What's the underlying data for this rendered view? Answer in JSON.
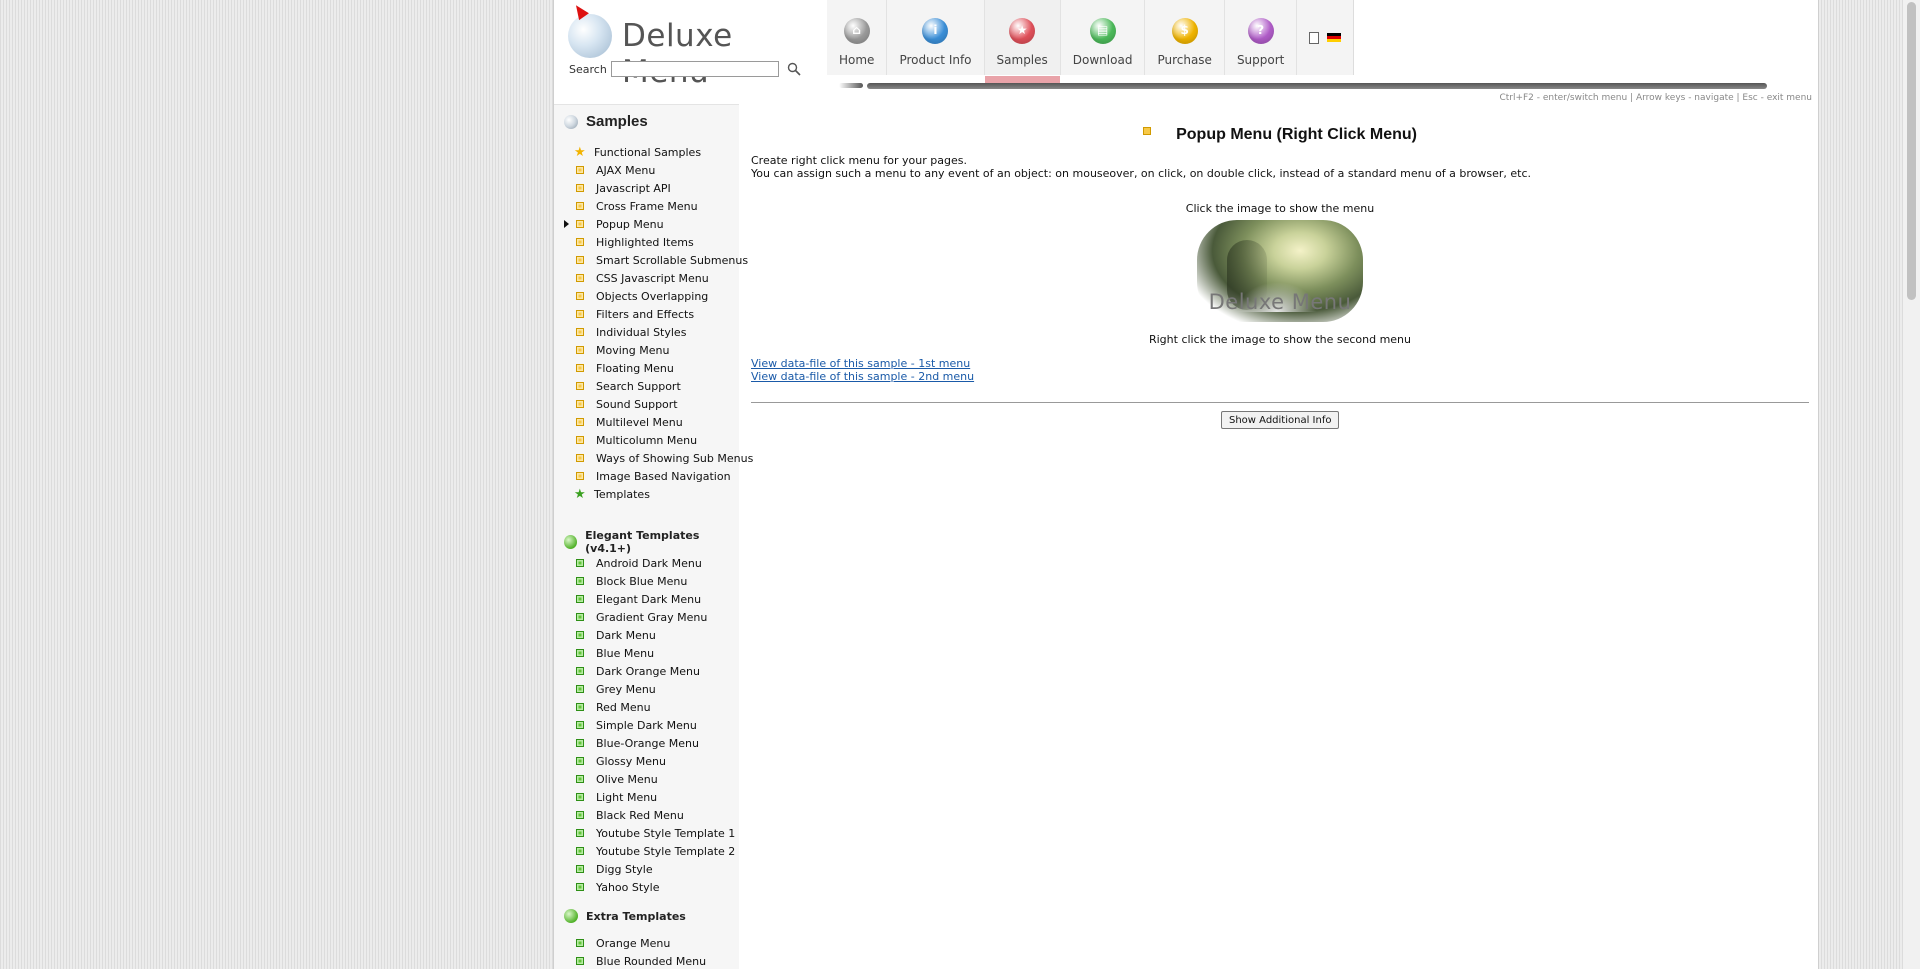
{
  "header": {
    "logo_text": "Deluxe Menu",
    "search_label": "Search",
    "search_value": "",
    "hint": "Ctrl+F2 - enter/switch menu | Arrow keys - navigate | Esc - exit menu"
  },
  "nav": {
    "items": [
      {
        "label": "Home",
        "color": "#9a9a9a",
        "icon": "home-icon"
      },
      {
        "label": "Product Info",
        "color": "#3b8fd8",
        "icon": "info-icon"
      },
      {
        "label": "Samples",
        "color": "#e0505a",
        "icon": "star-icon"
      },
      {
        "label": "Download",
        "color": "#4cba5a",
        "icon": "download-icon"
      },
      {
        "label": "Purchase",
        "color": "#f0b400",
        "icon": "dollar-icon"
      },
      {
        "label": "Support",
        "color": "#b05cc8",
        "icon": "question-icon"
      }
    ],
    "active": "Samples"
  },
  "sidebar": {
    "samples_heading": "Samples",
    "samples": [
      {
        "label": "Functional Samples",
        "icon": "star"
      },
      {
        "label": "AJAX Menu"
      },
      {
        "label": "Javascript API"
      },
      {
        "label": "Cross Frame Menu"
      },
      {
        "label": "Popup Menu",
        "current": true
      },
      {
        "label": "Highlighted Items"
      },
      {
        "label": "Smart Scrollable Submenus"
      },
      {
        "label": "CSS Javascript Menu"
      },
      {
        "label": "Objects Overlapping"
      },
      {
        "label": "Filters and Effects"
      },
      {
        "label": "Individual Styles"
      },
      {
        "label": "Moving Menu"
      },
      {
        "label": "Floating Menu"
      },
      {
        "label": "Search Support"
      },
      {
        "label": "Sound Support"
      },
      {
        "label": "Multilevel Menu"
      },
      {
        "label": "Multicolumn Menu"
      },
      {
        "label": "Ways of Showing Sub Menus"
      },
      {
        "label": "Image Based Navigation"
      },
      {
        "label": "Templates",
        "icon": "green-star"
      }
    ],
    "elegant_heading": "Elegant Templates (v4.1+)",
    "elegant": [
      "Android Dark Menu",
      "Block Blue Menu",
      "Elegant Dark Menu",
      "Gradient Gray Menu",
      "Dark Menu",
      "Blue Menu",
      "Dark Orange Menu",
      "Grey Menu",
      "Red Menu",
      "Simple Dark Menu",
      "Blue-Orange Menu",
      "Glossy Menu",
      "Olive Menu",
      "Light Menu",
      "Black Red Menu",
      "Youtube Style Template 1",
      "Youtube Style Template 2",
      "Digg Style",
      "Yahoo Style"
    ],
    "extra_heading": "Extra Templates",
    "extra": [
      "Orange Menu",
      "Blue Rounded Menu"
    ]
  },
  "main": {
    "title": "Popup Menu (Right Click Menu)",
    "desc_line1": "Create right click menu for your pages.",
    "desc_line2": "You can assign such a menu to any event of an object: on mouseover, on click, on double click, instead of a standard menu of a browser, etc.",
    "click_label": "Click the image to show the menu",
    "image_caption": "Deluxe Menu",
    "right_label": "Right click the image to show the second menu",
    "link1": "View data-file of this sample - 1st menu",
    "link2": "View data-file of this sample - 2nd menu",
    "info_button": "Show Additional Info"
  }
}
